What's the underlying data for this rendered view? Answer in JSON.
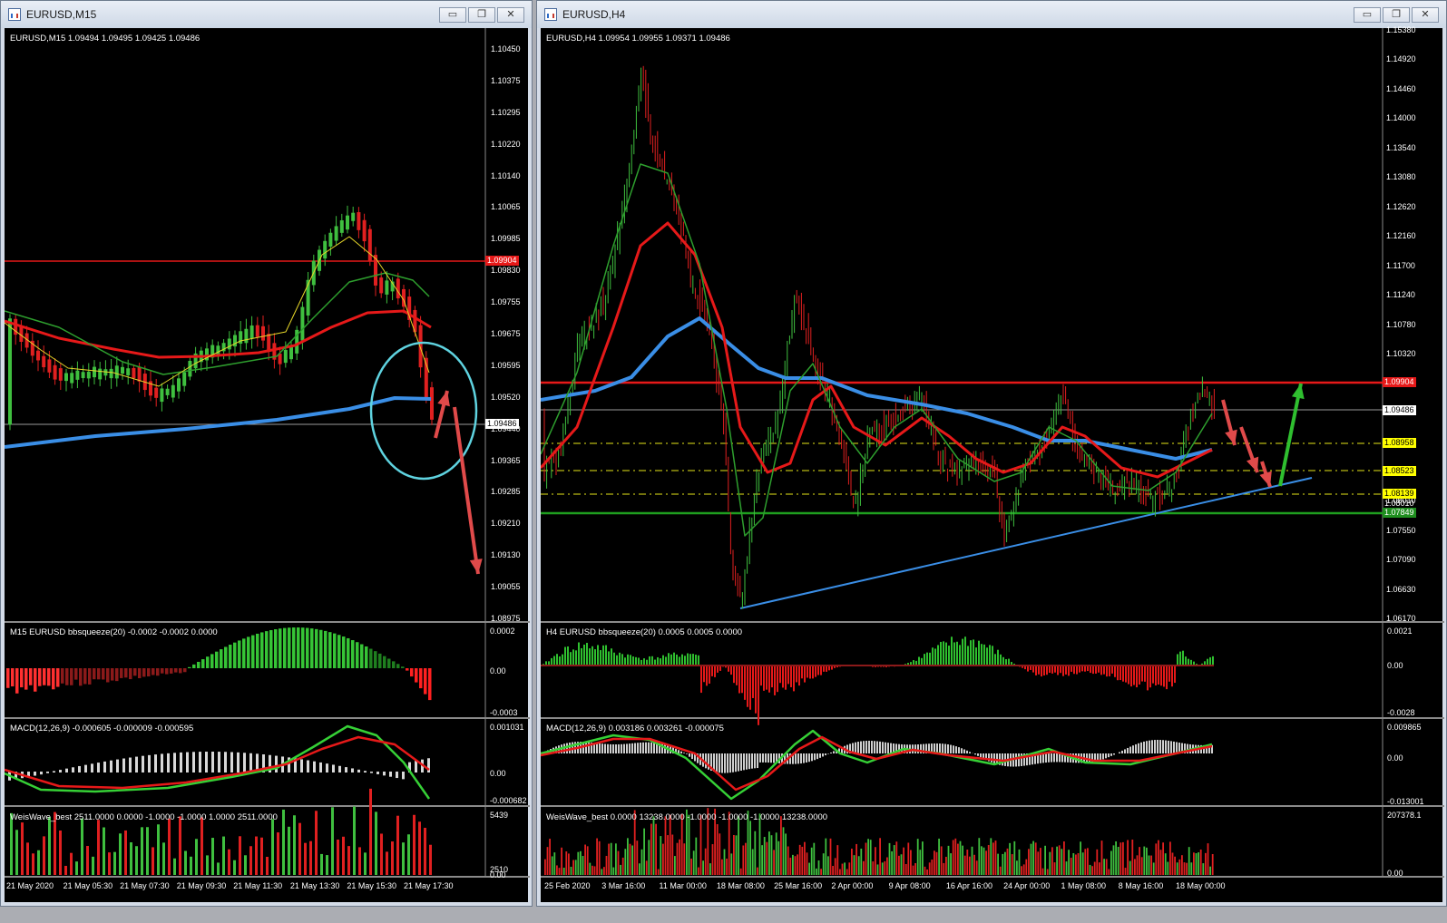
{
  "left_window": {
    "title": "EURUSD,M15",
    "header": "EURUSD,M15  1.09494 1.09495 1.09425 1.09486",
    "price_ticks": [
      "1.10450",
      "1.10375",
      "1.10295",
      "1.10220",
      "1.10140",
      "1.10065",
      "1.09985",
      "1.09830",
      "1.09755",
      "1.09675",
      "1.09595",
      "1.09520",
      "1.09440",
      "1.09365",
      "1.09285",
      "1.09210",
      "1.09130",
      "1.09055",
      "1.08975"
    ],
    "current_price_tag": "1.09486",
    "resistance_tag": "1.09904",
    "bbsqueeze_label": "M15 EURUSD bbsqueeze(20) -0.0002 -0.0002 0.0000",
    "bbsqueeze_ticks": [
      "0.0002",
      "0.00",
      "-0.0003"
    ],
    "macd_label": "MACD(12,26,9) -0.000605 -0.000009 -0.000595",
    "macd_ticks": [
      "0.001031",
      "0.00",
      "-0.000682"
    ],
    "weis_label": "WeisWave_best 2511.0000 0.0000 -1.0000 -1.0000 1.0000 2511.0000",
    "weis_ticks": [
      "5439",
      "2510",
      "0.00"
    ],
    "time_labels": [
      "21 May 2020",
      "21 May 05:30",
      "21 May 07:30",
      "21 May 09:30",
      "21 May 11:30",
      "21 May 13:30",
      "21 May 15:30",
      "21 May 17:30"
    ]
  },
  "right_window": {
    "title": "EURUSD,H4",
    "header": "EURUSD,H4  1.09954 1.09955 1.09371 1.09486",
    "price_ticks": [
      "1.15380",
      "1.14920",
      "1.14460",
      "1.14000",
      "1.13540",
      "1.13080",
      "1.12620",
      "1.12160",
      "1.11700",
      "1.11240",
      "1.10780",
      "1.10320",
      "1.09860",
      "1.09400",
      "1.08940",
      "1.08480",
      "1.08010",
      "1.07550",
      "1.07090",
      "1.06630",
      "1.06170"
    ],
    "tags": {
      "resistance": "1.09904",
      "current": "1.09486",
      "y1": "1.08958",
      "y2": "1.08523",
      "y3": "1.08139",
      "y4": "1.08010",
      "support": "1.07849"
    },
    "bbsqueeze_label": "H4 EURUSD bbsqueeze(20) 0.0005 0.0005 0.0000",
    "bbsqueeze_ticks": [
      "0.0021",
      "0.00",
      "-0.0028"
    ],
    "macd_label": "MACD(12,26,9) 0.003186 0.003261 -0.000075",
    "macd_ticks": [
      "0.009865",
      "0.00",
      "-0.013001"
    ],
    "weis_label": "WeisWave_best 0.0000 13238.0000 -1.0000 -1.0000 -1.0000 13238.0000",
    "weis_ticks": [
      "207378.1",
      "0.00"
    ],
    "time_labels": [
      "25 Feb 2020",
      "3 Mar 16:00",
      "11 Mar 00:00",
      "18 Mar 08:00",
      "25 Mar 16:00",
      "2 Apr 00:00",
      "9 Apr 08:00",
      "16 Apr 16:00",
      "24 Apr 00:00",
      "1 May 08:00",
      "8 May 16:00",
      "18 May 00:00"
    ]
  },
  "window_buttons": {
    "minimize": "▭",
    "restore": "❐",
    "close": "✕"
  },
  "colors": {
    "bull": "#3fbf3f",
    "bear": "#e02020",
    "ma_slow": "#3a8ee6",
    "ma_red": "#e61919",
    "circle": "#5fd3e0",
    "tag_yellow": "#ffff00",
    "tag_red": "#e61919",
    "tag_green": "#1f8f1f"
  }
}
